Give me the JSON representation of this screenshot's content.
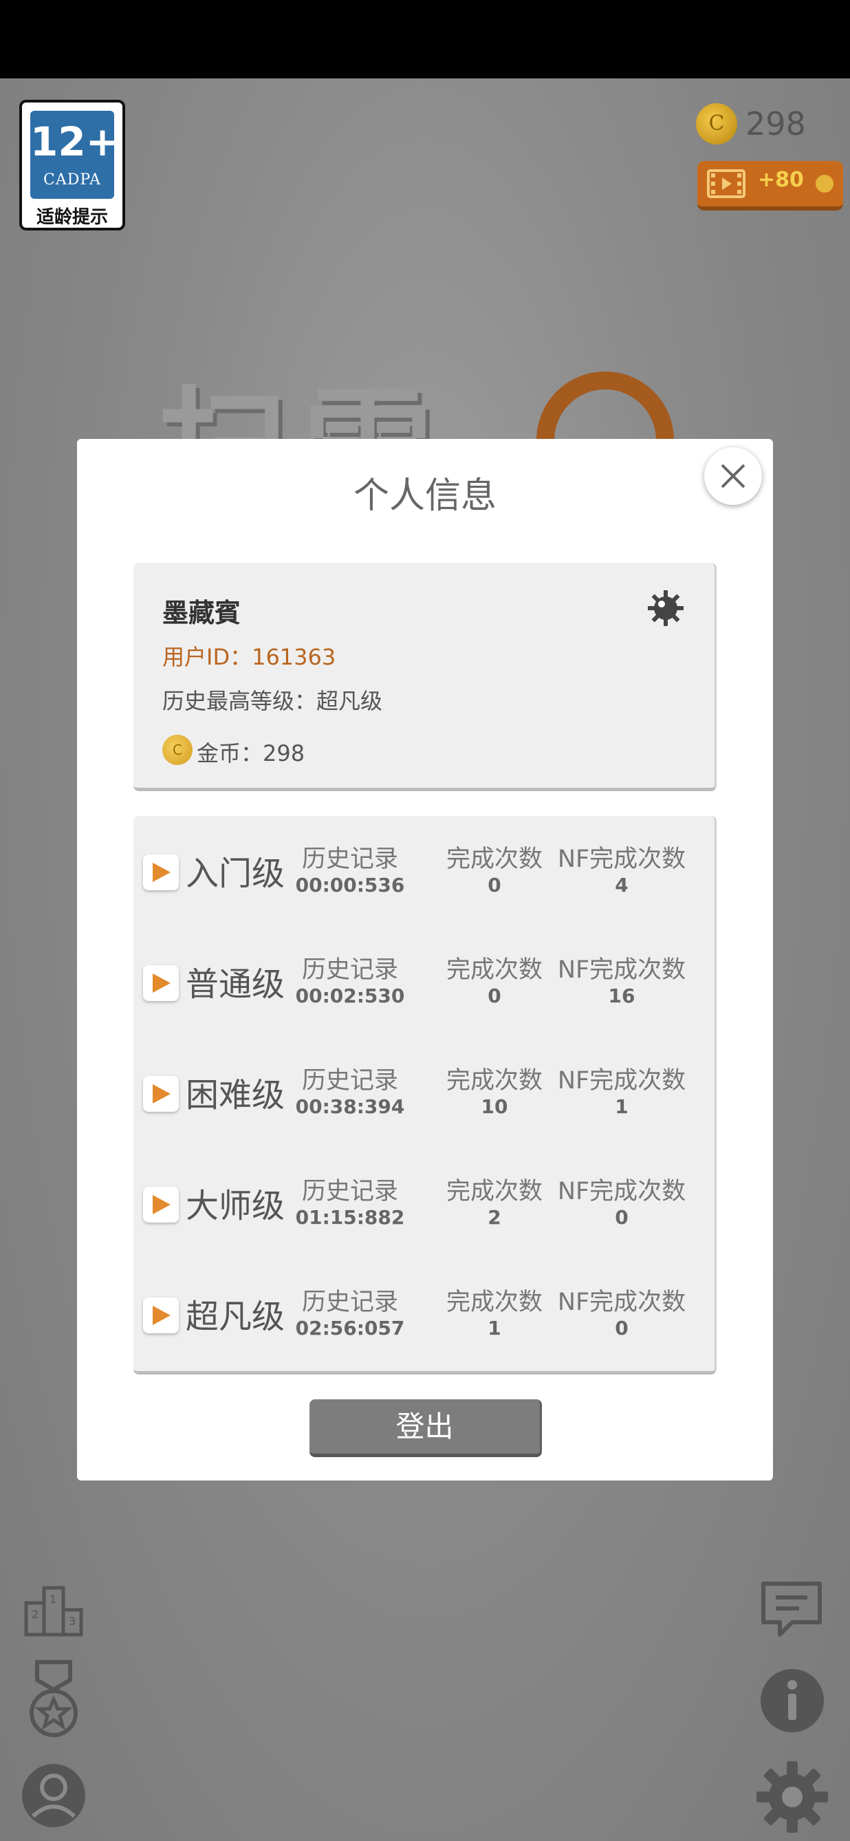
{
  "age_badge": {
    "number": "12+",
    "org": "CADPA",
    "label": "适龄提示"
  },
  "coins": {
    "icon_letter": "C",
    "count": "298"
  },
  "video_reward": {
    "label": "+80"
  },
  "background_title": "扫雷",
  "dialog": {
    "title": "个人信息",
    "profile": {
      "name": "墨藏賓",
      "user_id": "用户ID：161363",
      "highest_level": "历史最高等级：超凡级",
      "coin_icon_letter": "C",
      "coins": "金币：298"
    },
    "levels": [
      {
        "name": "入门级",
        "record_label": "历史记录",
        "record": "00:00:536",
        "complete_label": "完成次数",
        "complete": "0",
        "nf_label": "NF完成次数",
        "nf": "4"
      },
      {
        "name": "普通级",
        "record_label": "历史记录",
        "record": "00:02:530",
        "complete_label": "完成次数",
        "complete": "0",
        "nf_label": "NF完成次数",
        "nf": "16"
      },
      {
        "name": "困难级",
        "record_label": "历史记录",
        "record": "00:38:394",
        "complete_label": "完成次数",
        "complete": "10",
        "nf_label": "NF完成次数",
        "nf": "1"
      },
      {
        "name": "大师级",
        "record_label": "历史记录",
        "record": "01:15:882",
        "complete_label": "完成次数",
        "complete": "2",
        "nf_label": "NF完成次数",
        "nf": "0"
      },
      {
        "name": "超凡级",
        "record_label": "历史记录",
        "record": "02:56:057",
        "complete_label": "完成次数",
        "complete": "1",
        "nf_label": "NF完成次数",
        "nf": "0"
      }
    ],
    "logout_label": "登出"
  },
  "icons": {
    "close": "close-icon",
    "settings_small": "bomb-settings-icon",
    "leaderboard": "podium-icon",
    "medal": "medal-icon",
    "profile": "user-icon",
    "chat": "chat-icon",
    "info": "info-icon",
    "settings": "gear-icon"
  },
  "colors": {
    "accent": "#c86a1c",
    "id_text": "#b9651f",
    "button": "#7d7d7d"
  }
}
